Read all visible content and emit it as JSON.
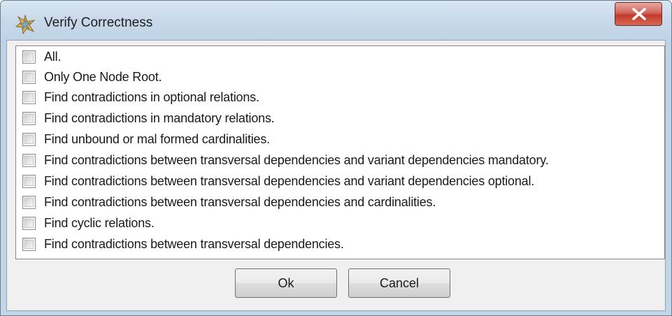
{
  "window": {
    "title": "Verify Correctness",
    "app_icon": "starburst-icon",
    "close_icon": "close-icon"
  },
  "checklist": {
    "items": [
      {
        "label": "All.",
        "checked": false
      },
      {
        "label": "Only One Node Root.",
        "checked": false
      },
      {
        "label": "Find contradictions in optional relations.",
        "checked": false
      },
      {
        "label": "Find contradictions in mandatory relations.",
        "checked": false
      },
      {
        "label": "Find unbound or mal formed cardinalities.",
        "checked": false
      },
      {
        "label": "Find contradictions between transversal dependencies and variant dependencies mandatory.",
        "checked": false
      },
      {
        "label": "Find contradictions between transversal dependencies and variant dependencies optional.",
        "checked": false
      },
      {
        "label": "Find contradictions between transversal dependencies and cardinalities.",
        "checked": false
      },
      {
        "label": "Find cyclic relations.",
        "checked": false
      },
      {
        "label": "Find contradictions between transversal dependencies.",
        "checked": false
      }
    ]
  },
  "buttons": {
    "ok_label": "Ok",
    "cancel_label": "Cancel"
  }
}
